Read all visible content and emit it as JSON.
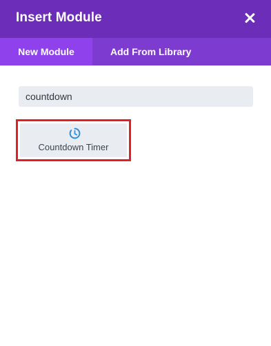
{
  "dialog": {
    "title": "Insert Module",
    "close_icon": "close-icon"
  },
  "tabs": [
    {
      "label": "New Module",
      "active": true
    },
    {
      "label": "Add From Library",
      "active": false
    }
  ],
  "search": {
    "value": "countdown",
    "placeholder": ""
  },
  "modules": [
    {
      "label": "Countdown Timer",
      "icon": "countdown-timer-icon",
      "highlighted": true
    }
  ],
  "colors": {
    "header": "#6c2eb9",
    "tab_bar": "#7e3bd0",
    "tab_active": "#8f42ec",
    "input_bg": "#e9edf2",
    "highlight": "#e01f26",
    "icon": "#2e8fd6"
  }
}
